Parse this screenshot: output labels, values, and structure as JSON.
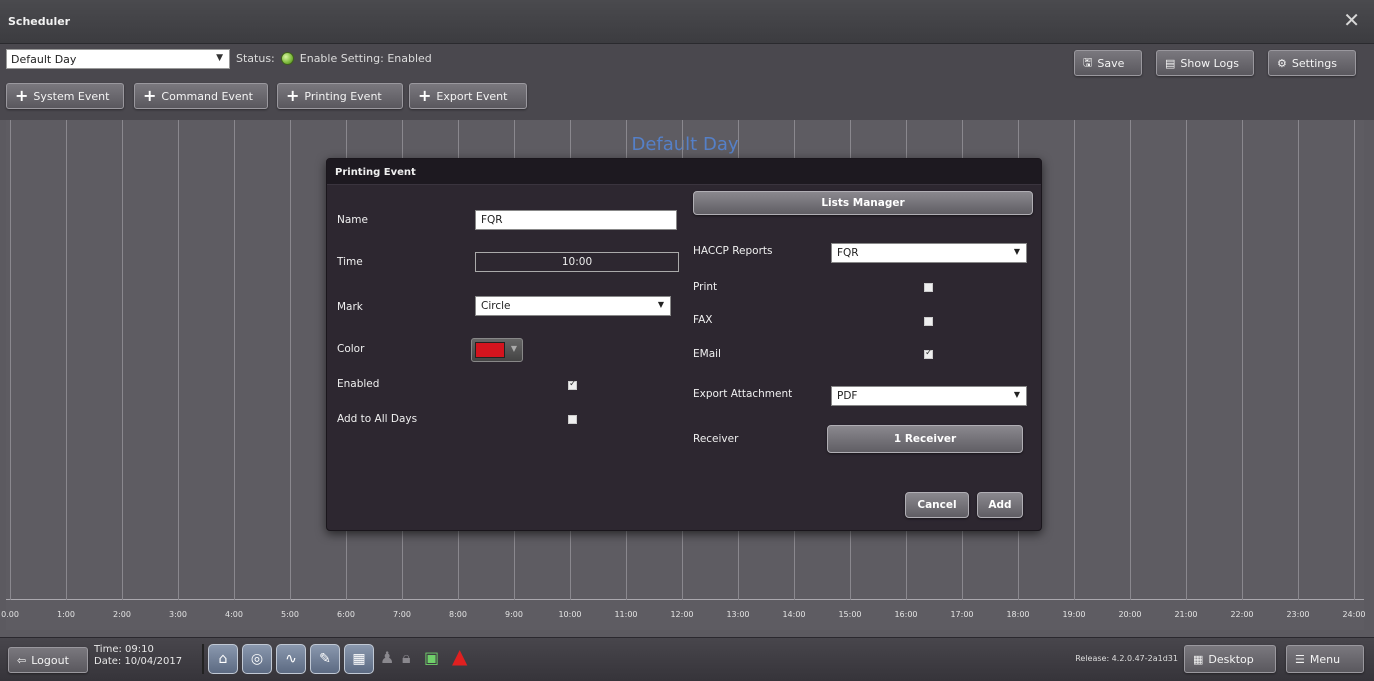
{
  "window": {
    "title": "Scheduler",
    "close_glyph": "✕"
  },
  "toolbar": {
    "day_select": "Default Day",
    "status_label": "Status:",
    "enable_setting": "Enable Setting: Enabled",
    "save": "Save",
    "show_logs": "Show Logs",
    "settings": "Settings",
    "add_buttons": [
      "System Event",
      "Command Event",
      "Printing Event",
      "Export Event"
    ]
  },
  "chart": {
    "title": "Default Day",
    "hours": [
      "0.00",
      "1:00",
      "2:00",
      "3:00",
      "4:00",
      "5:00",
      "6:00",
      "7:00",
      "8:00",
      "9:00",
      "10:00",
      "11:00",
      "12:00",
      "13:00",
      "14:00",
      "15:00",
      "16:00",
      "17:00",
      "18:00",
      "19:00",
      "20:00",
      "21:00",
      "22:00",
      "23:00",
      "24:00"
    ]
  },
  "dialog": {
    "title": "Printing Event",
    "name_label": "Name",
    "name_value": "FQR",
    "time_label": "Time",
    "time_value": "10:00",
    "mark_label": "Mark",
    "mark_value": "Circle",
    "color_label": "Color",
    "color_value": "#d4141e",
    "enabled_label": "Enabled",
    "enabled": true,
    "add_all_days_label": "Add to All Days",
    "add_all_days": false,
    "lists_manager": "Lists Manager",
    "haccp_label": "HACCP Reports",
    "haccp_value": "FQR",
    "print_label": "Print",
    "print": false,
    "fax_label": "FAX",
    "fax": false,
    "email_label": "EMail",
    "email": true,
    "export_label": "Export Attachment",
    "export_value": "PDF",
    "receiver_label": "Receiver",
    "receiver_button": "1 Receiver",
    "cancel": "Cancel",
    "add": "Add"
  },
  "bottombar": {
    "logout": "Logout",
    "time": "Time: 09:10",
    "date": "Date: 10/04/2017",
    "version": "Release: 4.2.0.47-2a1d31",
    "desktop": "Desktop",
    "menu": "Menu"
  },
  "colors": {
    "chart_title": "#5580c8",
    "status_ok": "#7bb83a",
    "alert": "#e02020"
  }
}
